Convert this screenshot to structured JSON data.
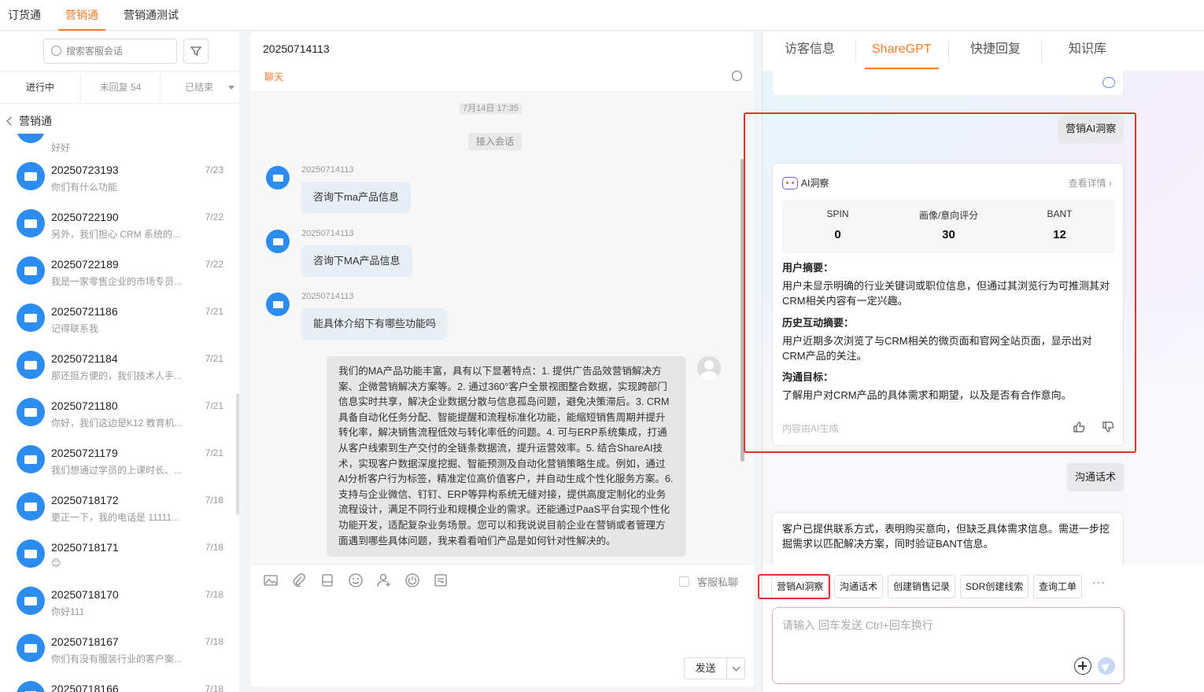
{
  "top_tabs": [
    {
      "label": "订货通",
      "active": false
    },
    {
      "label": "营销通",
      "active": true
    },
    {
      "label": "营销通测试",
      "active": false
    }
  ],
  "left": {
    "search_placeholder": "搜索客服会话",
    "subtabs": [
      "进行中",
      "未回复 54",
      "已结束"
    ],
    "group_label": "营销通",
    "partial_top_preview": "好好",
    "sessions": [
      {
        "name": "20250723193",
        "date": "7/23",
        "preview": "你们有什么功能"
      },
      {
        "name": "20250722190",
        "date": "7/22",
        "preview": "另外，我们担心 CRM 系统的..."
      },
      {
        "name": "20250722189",
        "date": "7/22",
        "preview": "我是一家零售企业的市场专员..."
      },
      {
        "name": "20250721186",
        "date": "7/21",
        "preview": "记得联系我"
      },
      {
        "name": "20250721184",
        "date": "7/21",
        "preview": "那还挺方便的，我们技术人手..."
      },
      {
        "name": "20250721180",
        "date": "7/21",
        "preview": "你好，我们这边是K12 教育机..."
      },
      {
        "name": "20250721179",
        "date": "7/21",
        "preview": "我们想通过学员的上课时长、..."
      },
      {
        "name": "20250718172",
        "date": "7/18",
        "preview": "更正一下，我的电话是 11111..."
      },
      {
        "name": "20250718171",
        "date": "7/18",
        "preview": "😊"
      },
      {
        "name": "20250718170",
        "date": "7/18",
        "preview": "你好111"
      },
      {
        "name": "20250718167",
        "date": "7/18",
        "preview": "你们有没有服装行业的客户案..."
      },
      {
        "name": "20250718166",
        "date": "7/18",
        "preview": ""
      }
    ]
  },
  "chat": {
    "title": "20250714113",
    "subtitle": "聊天",
    "time_label": "7月14日 17:35",
    "join_label": "接入会话",
    "messages": [
      {
        "sender": "20250714113",
        "text": "咨询下ma产品信息"
      },
      {
        "sender": "20250714113",
        "text": "咨询下MA产品信息"
      },
      {
        "sender": "20250714113",
        "text": "能具体介绍下有哪些功能吗"
      }
    ],
    "agent_reply": "我们的MA产品功能丰富，具有以下显著特点：1. 提供广告品效营销解决方案、企微营销解决方案等。2. 通过360°客户全景视图整合数据，实现跨部门信息实时共享，解决企业数据分散与信息孤岛问题，避免决策滞后。3. CRM具备自动化任务分配、智能提醒和流程标准化功能，能缩短销售周期并提升转化率，解决销售流程低效与转化率低的问题。4. 可与ERP系统集成，打通从客户线索到生产交付的全链条数据流，提升运营效率。5. 结合ShareAI技术，实现客户数据深度挖掘、智能预测及自动化营销策略生成。例如，通过AI分析客户行为标签，精准定位高价值客户，并自动生成个性化服务方案。6. 支持与企业微信、钉钉、ERP等异构系统无缝对接，提供高度定制化的业务流程设计，满足不同行业和规模企业的需求。还能通过PaaS平台实现个性化功能开发，适配复杂业务场景。您可以和我说说目前企业在营销或者管理方面遇到哪些具体问题，我来看看咱们产品是如何针对性解决的。",
    "private_label": "客服私聊",
    "send_label": "发送"
  },
  "right": {
    "tabs": [
      {
        "label": "访客信息",
        "active": false
      },
      {
        "label": "ShareGPT",
        "active": true
      },
      {
        "label": "快捷回复",
        "active": false
      },
      {
        "label": "知识库",
        "active": false
      }
    ],
    "user_chip_1": "营销AI洞察",
    "insight": {
      "title": "AI洞察",
      "detail_link": "查看详情 ›",
      "metrics": [
        {
          "label": "SPIN",
          "value": "0"
        },
        {
          "label": "画像/意向评分",
          "value": "30"
        },
        {
          "label": "BANT",
          "value": "12"
        }
      ],
      "sections": [
        {
          "heading": "用户摘要：",
          "body": "用户未显示明确的行业关键词或职位信息，但通过其浏览行为可推测其对CRM相关内容有一定兴趣。"
        },
        {
          "heading": "历史互动摘要：",
          "body": "用户近期多次浏览了与CRM相关的微页面和官网全站页面，显示出对CRM产品的关注。"
        },
        {
          "heading": "沟通目标：",
          "body": "了解用户对CRM产品的具体需求和期望，以及是否有合作意向。"
        }
      ],
      "footer": "内容由AI生成"
    },
    "user_chip_2": "沟通话术",
    "talk_reply": "客户已提供联系方式，表明购买意向，但缺乏具体需求信息。需进一步挖掘需求以匹配解决方案，同时验证BANT信息。",
    "quick_actions": [
      "营销AI洞察",
      "沟通话术",
      "创建销售记录",
      "SDR创建线索",
      "查询工单"
    ],
    "more_label": "···",
    "input_placeholder": "请输入 回车发送 Ctrl+回车换行"
  },
  "colors": {
    "accent": "#f57c2a",
    "avatar_blue": "#2d8cf0",
    "highlight_red": "#e5322d"
  }
}
